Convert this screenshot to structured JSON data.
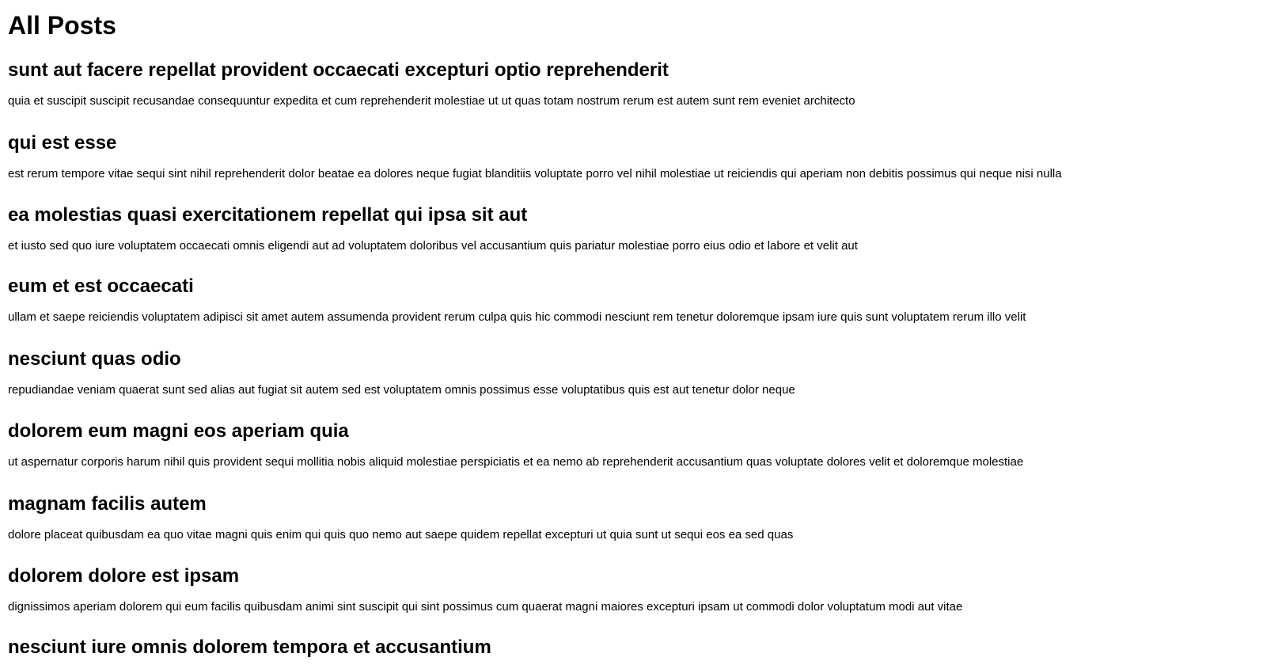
{
  "page": {
    "title": "All Posts"
  },
  "posts": [
    {
      "title": "sunt aut facere repellat provident occaecati excepturi optio reprehenderit",
      "body": "quia et suscipit suscipit recusandae consequuntur expedita et cum reprehenderit molestiae ut ut quas totam nostrum rerum est autem sunt rem eveniet architecto"
    },
    {
      "title": "qui est esse",
      "body": "est rerum tempore vitae sequi sint nihil reprehenderit dolor beatae ea dolores neque fugiat blanditiis voluptate porro vel nihil molestiae ut reiciendis qui aperiam non debitis possimus qui neque nisi nulla"
    },
    {
      "title": "ea molestias quasi exercitationem repellat qui ipsa sit aut",
      "body": "et iusto sed quo iure voluptatem occaecati omnis eligendi aut ad voluptatem doloribus vel accusantium quis pariatur molestiae porro eius odio et labore et velit aut"
    },
    {
      "title": "eum et est occaecati",
      "body": "ullam et saepe reiciendis voluptatem adipisci sit amet autem assumenda provident rerum culpa quis hic commodi nesciunt rem tenetur doloremque ipsam iure quis sunt voluptatem rerum illo velit"
    },
    {
      "title": "nesciunt quas odio",
      "body": "repudiandae veniam quaerat sunt sed alias aut fugiat sit autem sed est voluptatem omnis possimus esse voluptatibus quis est aut tenetur dolor neque"
    },
    {
      "title": "dolorem eum magni eos aperiam quia",
      "body": "ut aspernatur corporis harum nihil quis provident sequi mollitia nobis aliquid molestiae perspiciatis et ea nemo ab reprehenderit accusantium quas voluptate dolores velit et doloremque molestiae"
    },
    {
      "title": "magnam facilis autem",
      "body": "dolore placeat quibusdam ea quo vitae magni quis enim qui quis quo nemo aut saepe quidem repellat excepturi ut quia sunt ut sequi eos ea sed quas"
    },
    {
      "title": "dolorem dolore est ipsam",
      "body": "dignissimos aperiam dolorem qui eum facilis quibusdam animi sint suscipit qui sint possimus cum quaerat magni maiores excepturi ipsam ut commodi dolor voluptatum modi aut vitae"
    },
    {
      "title": "nesciunt iure omnis dolorem tempora et accusantium",
      "body": ""
    }
  ]
}
